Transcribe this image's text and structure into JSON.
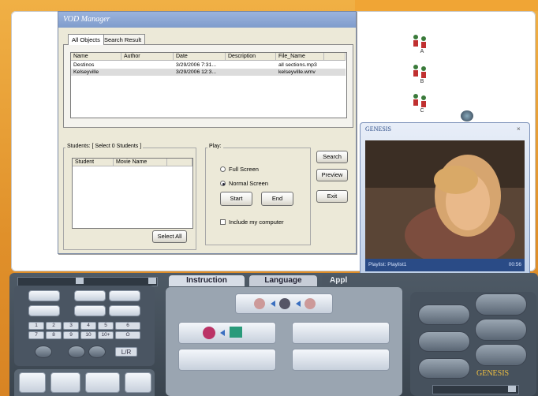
{
  "vod": {
    "title": "VOD Manager",
    "tabs": [
      "All Objects",
      "Search Result"
    ],
    "columns": [
      "Name",
      "Author",
      "Date",
      "Description",
      "File_Name"
    ],
    "rows": [
      {
        "name": "Destinos",
        "author": "",
        "date": "3/29/2006 7:31...",
        "description": "",
        "file": "all sections.mp3"
      },
      {
        "name": "Kelseyville",
        "author": "",
        "date": "3/29/2006 12:3...",
        "description": "",
        "file": "kelseyville.wmv"
      }
    ],
    "students_label": "Students: [ Select  0  Students ]",
    "student_columns": [
      "Student",
      "Movie Name"
    ],
    "select_all": "Select All",
    "play_label": "Play:",
    "full_screen": "Full Screen",
    "normal_screen": "Normal Screen",
    "start": "Start",
    "end": "End",
    "include_computer": "Include my computer",
    "search": "Search",
    "preview": "Preview",
    "exit": "Exit"
  },
  "whiteboard": {
    "avatars": [
      "A",
      "B",
      "C"
    ]
  },
  "player": {
    "brand": "GENESIS",
    "playlist": "Playlist: Playlist1",
    "time": "00:56"
  },
  "console": {
    "tabs": [
      "Instruction",
      "Language",
      "Appl"
    ],
    "keypad": [
      "1",
      "2",
      "3",
      "4",
      "5",
      "6",
      "7",
      "8",
      "9",
      "10",
      "10+",
      "O"
    ],
    "lr": "L/R",
    "brand": "GENESIS"
  },
  "colors": {
    "frame": "#e89a2a",
    "vod_title": "#8ea8d6",
    "console": "#45505b",
    "video_bar": "#2a4b86"
  },
  "icons": [
    "people-icon",
    "arrow-right-icon",
    "teacher-icon",
    "monitor-icon",
    "lock-icon",
    "unlock-icon",
    "gear-icon"
  ]
}
